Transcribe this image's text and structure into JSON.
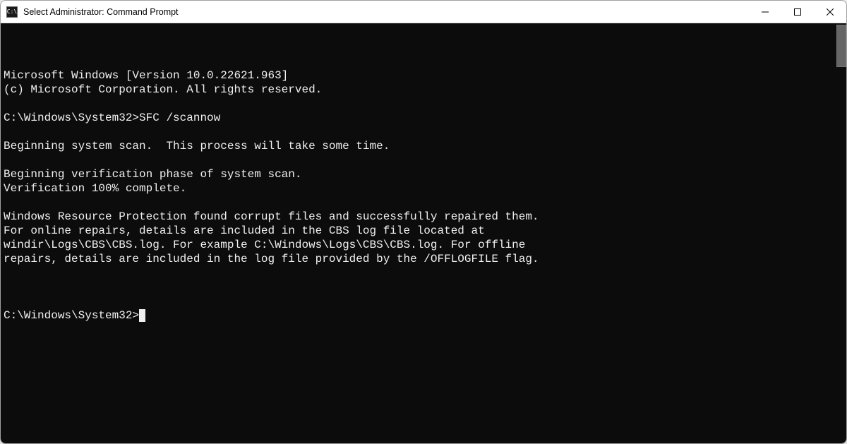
{
  "window": {
    "title": "Select Administrator: Command Prompt"
  },
  "terminal": {
    "lines": [
      "Microsoft Windows [Version 10.0.22621.963]",
      "(c) Microsoft Corporation. All rights reserved.",
      "",
      "C:\\Windows\\System32>SFC /scannow",
      "",
      "Beginning system scan.  This process will take some time.",
      "",
      "Beginning verification phase of system scan.",
      "Verification 100% complete.",
      "",
      "Windows Resource Protection found corrupt files and successfully repaired them.",
      "For online repairs, details are included in the CBS log file located at",
      "windir\\Logs\\CBS\\CBS.log. For example C:\\Windows\\Logs\\CBS\\CBS.log. For offline",
      "repairs, details are included in the log file provided by the /OFFLOGFILE flag.",
      ""
    ],
    "current_prompt": "C:\\Windows\\System32>"
  }
}
